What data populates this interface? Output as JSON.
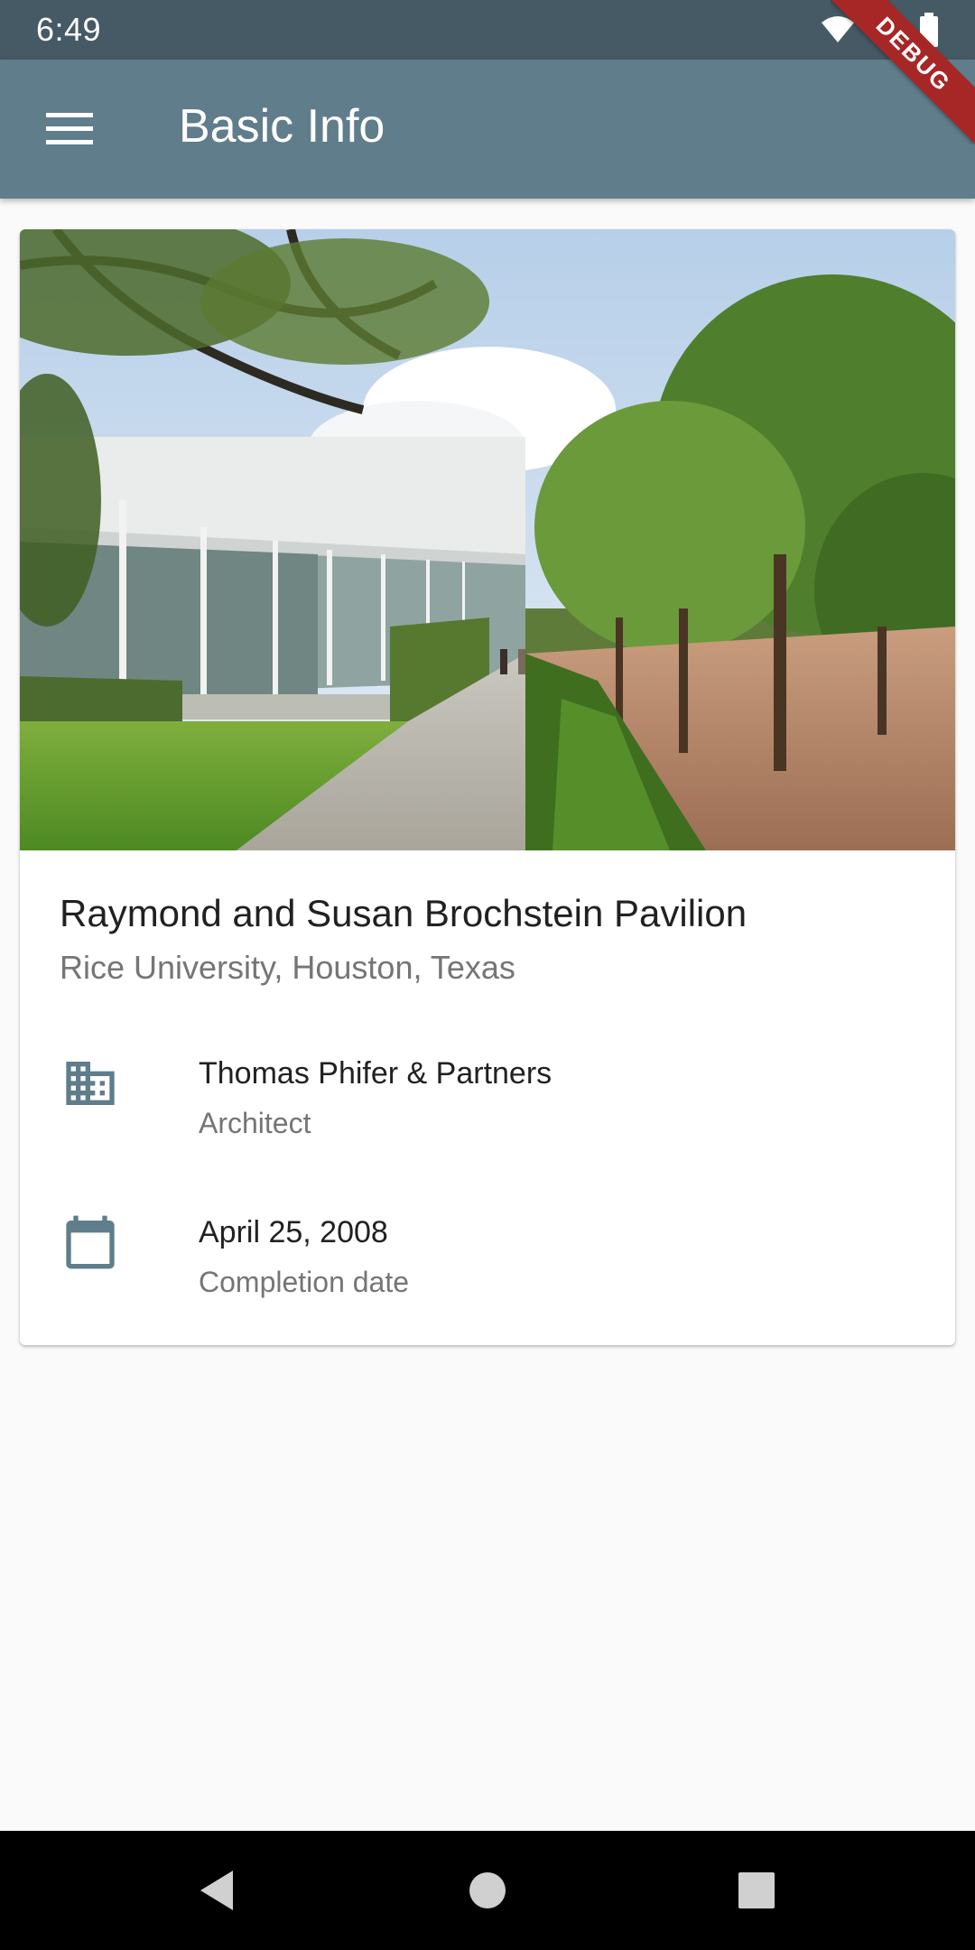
{
  "status_bar": {
    "time": "6:49",
    "icons": [
      "wifi-icon",
      "signal-icon",
      "battery-icon"
    ],
    "debug_label": "DEBUG"
  },
  "app_bar": {
    "title": "Basic Info",
    "menu_icon": "menu-icon"
  },
  "card": {
    "image": "pavilion-photo",
    "title": "Raymond and Susan Brochstein Pavilion",
    "subtitle": "Rice University, Houston, Texas",
    "rows": [
      {
        "icon": "building-icon",
        "primary": "Thomas Phifer & Partners",
        "secondary": "Architect"
      },
      {
        "icon": "calendar-icon",
        "primary": "April 25, 2008",
        "secondary": "Completion date"
      }
    ]
  },
  "nav_bar": {
    "buttons": [
      "back-icon",
      "home-icon",
      "recents-icon"
    ]
  },
  "colors": {
    "status_bar": "#455a64",
    "app_bar": "#607d8b",
    "icon": "#607d8b",
    "debug_banner": "#a72626"
  }
}
